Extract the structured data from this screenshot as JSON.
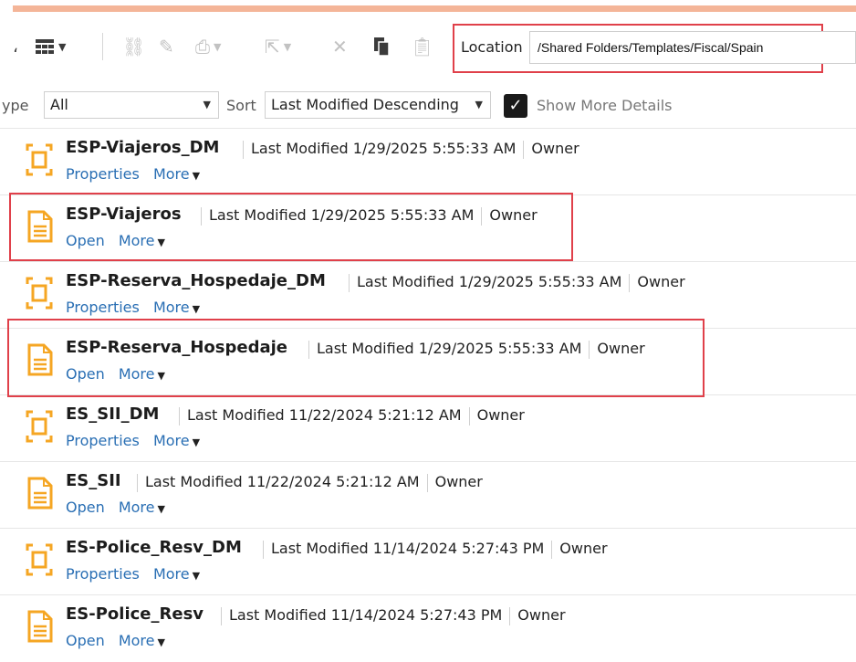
{
  "toolbar": {
    "location_label": "Location",
    "location_value": "/Shared Folders/Templates/Fiscal/Spain"
  },
  "filters": {
    "type_label": "ype",
    "type_value": "All",
    "sort_label": "Sort",
    "sort_value": "Last Modified Descending",
    "show_more_details": "Show More Details",
    "show_more_checked": true
  },
  "items": [
    {
      "name": "ESP-Viajeros_DM",
      "modified": "Last Modified 1/29/2025 5:55:33 AM",
      "owner": "Owner",
      "action1": "Properties",
      "action2": "More",
      "icon": "data-model-icon"
    },
    {
      "name": "ESP-Viajeros",
      "modified": "Last Modified 1/29/2025 5:55:33 AM",
      "owner": "Owner",
      "action1": "Open",
      "action2": "More",
      "icon": "report-icon"
    },
    {
      "name": "ESP-Reserva_Hospedaje_DM",
      "modified": "Last Modified 1/29/2025 5:55:33 AM",
      "owner": "Owner",
      "action1": "Properties",
      "action2": "More",
      "icon": "data-model-icon"
    },
    {
      "name": "ESP-Reserva_Hospedaje",
      "modified": "Last Modified 1/29/2025 5:55:33 AM",
      "owner": "Owner",
      "action1": "Open",
      "action2": "More",
      "icon": "report-icon"
    },
    {
      "name": "ES_SII_DM",
      "modified": "Last Modified 11/22/2024 5:21:12 AM",
      "owner": "Owner",
      "action1": "Properties",
      "action2": "More",
      "icon": "data-model-icon"
    },
    {
      "name": "ES_SII",
      "modified": "Last Modified 11/22/2024 5:21:12 AM",
      "owner": "Owner",
      "action1": "Open",
      "action2": "More",
      "icon": "report-icon"
    },
    {
      "name": "ES-Police_Resv_DM",
      "modified": "Last Modified 11/14/2024 5:27:43 PM",
      "owner": "Owner",
      "action1": "Properties",
      "action2": "More",
      "icon": "data-model-icon"
    },
    {
      "name": "ES-Police_Resv",
      "modified": "Last Modified 11/14/2024 5:27:43 PM",
      "owner": "Owner",
      "action1": "Open",
      "action2": "More",
      "icon": "report-icon"
    }
  ],
  "colors": {
    "accent_stripe": "#f4b598",
    "highlight": "#e0404a",
    "link": "#2a6fb4",
    "icon": "#f5a623"
  }
}
